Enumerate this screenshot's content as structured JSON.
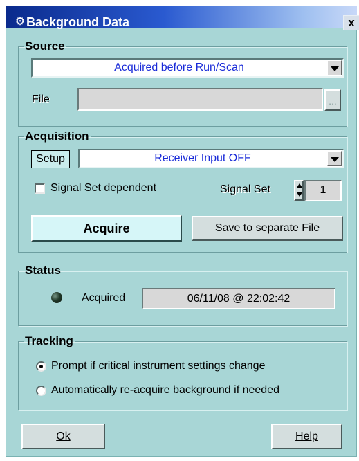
{
  "window": {
    "title": "Background Data",
    "close_label": "x",
    "title_icon": "rtf-app-icon"
  },
  "source": {
    "legend": "Source",
    "selected": "Acquired before Run/Scan",
    "file_label": "File",
    "file_value": "",
    "browse_label": "..."
  },
  "acquisition": {
    "legend": "Acquisition",
    "setup_label": "Setup",
    "setup_selected": "Receiver Input OFF",
    "signal_set_dependent_label": "Signal Set dependent",
    "signal_set_dependent_checked": false,
    "signal_set_label": "Signal Set",
    "signal_set_value": "1",
    "acquire_label": "Acquire",
    "save_label": "Save to separate File"
  },
  "status": {
    "legend": "Status",
    "state_label": "Acquired",
    "timestamp": "06/11/08 @ 22:02:42",
    "indicator_color": "#1f3526"
  },
  "tracking": {
    "legend": "Tracking",
    "options": [
      {
        "label": "Prompt if critical instrument settings change",
        "selected": true
      },
      {
        "label": "Automatically re-acquire background if needed",
        "selected": false
      }
    ]
  },
  "footer": {
    "ok_label": "Ok",
    "help_label": "Help"
  },
  "colors": {
    "window_bg": "#a8d6d6",
    "title_start": "#0a2a8c",
    "combo_text": "#1a2bd8"
  }
}
